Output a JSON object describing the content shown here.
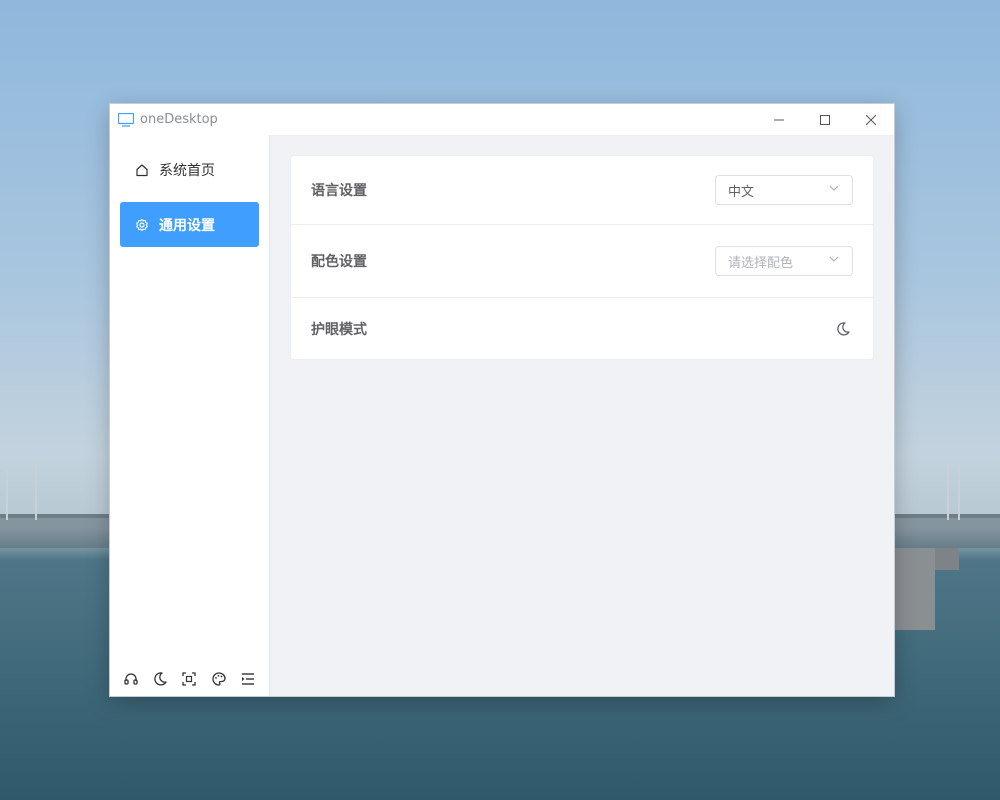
{
  "window": {
    "title": "oneDesktop"
  },
  "sidebar": {
    "items": [
      {
        "label": "系统首页",
        "icon": "home-icon"
      },
      {
        "label": "通用设置",
        "icon": "gear-icon",
        "active": true
      }
    ],
    "tools": [
      "headset-icon",
      "moon-icon",
      "fullscreen-icon",
      "palette-icon",
      "menu-fold-icon"
    ]
  },
  "settings": {
    "language": {
      "label": "语言设置",
      "value": "中文"
    },
    "color": {
      "label": "配色设置",
      "placeholder": "请选择配色"
    },
    "eye_care": {
      "label": "护眼模式",
      "icon": "moon-icon"
    }
  },
  "colors": {
    "accent": "#409eff",
    "background": "#f0f2f5",
    "text": "#606266"
  }
}
